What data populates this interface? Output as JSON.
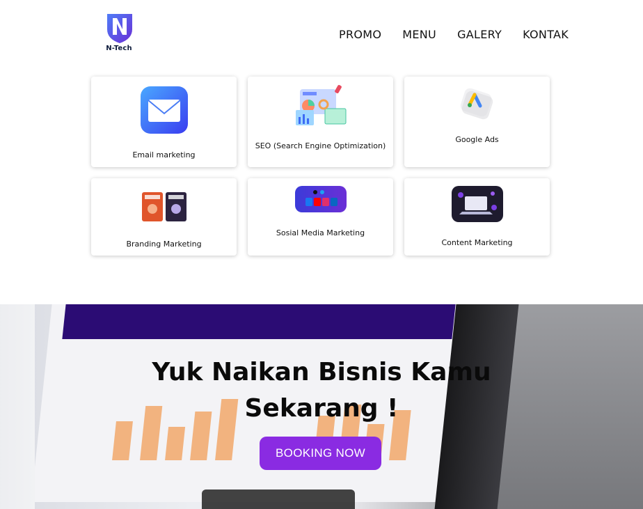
{
  "brand": {
    "name": "N-Tech",
    "logo_icon": "n-shield-logo"
  },
  "nav": {
    "items": [
      "PROMO",
      "MENU",
      "GALERY",
      "KONTAK"
    ]
  },
  "services": [
    {
      "label": "Email marketing",
      "icon": "envelope-icon"
    },
    {
      "label": "SEO (Search Engine Optimization)",
      "icon": "seo-analytics-icon"
    },
    {
      "label": "Google Ads",
      "icon": "google-ads-icon"
    },
    {
      "label": "Branding Marketing",
      "icon": "product-packaging-icon"
    },
    {
      "label": "Sosial Media Marketing",
      "icon": "social-media-icon"
    },
    {
      "label": "Content Marketing",
      "icon": "content-laptop-icon"
    }
  ],
  "hero": {
    "title_line1": "Yuk Naikan Bisnis Kamu",
    "title_line2": "Sekarang !",
    "button_label": "BOOKING NOW"
  },
  "colors": {
    "accent": "#8a2be2",
    "logo_blue": "#3b5bdb",
    "text": "#111111"
  }
}
